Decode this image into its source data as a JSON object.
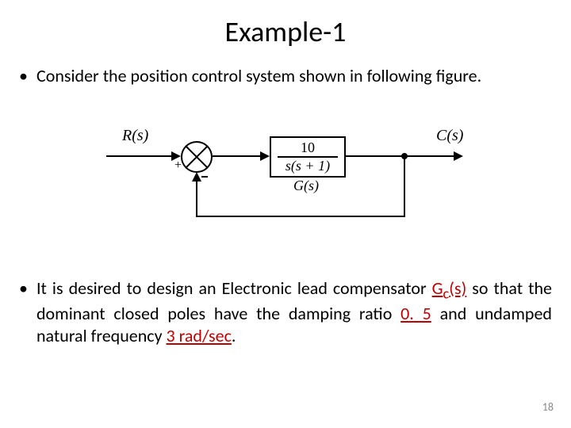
{
  "title": "Example-1",
  "bullets": [
    "Consider the position control system shown in following figure.",
    "It is desired to design an Electronic lead compensator "
  ],
  "bullet2_parts": {
    "pre": "It is desired to design an Electronic lead compensator ",
    "gc": "G",
    "gc_sub": "c",
    "gc_post": "(s)",
    "mid": " so that the dominant closed poles have the damping ratio ",
    "damp": "0. 5",
    "mid2": " and undamped natural frequency ",
    "freq": "3 rad/sec",
    "end": "."
  },
  "diagram": {
    "input": "R(s)",
    "output": "C(s)",
    "plus": "+",
    "tf_num": "10",
    "tf_den": "s(s + 1)",
    "tf_label": "G(s)"
  },
  "page": "18"
}
